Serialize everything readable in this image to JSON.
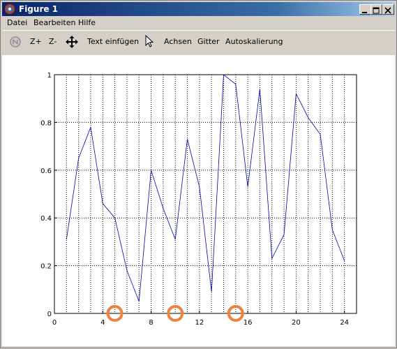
{
  "window": {
    "title": "Figure 1"
  },
  "menu": {
    "items": [
      "Datei",
      "Bearbeiten",
      "Hilfe"
    ]
  },
  "toolbar": {
    "zoom_in": "Z+",
    "zoom_out": "Z-",
    "insert_text": "Text einfügen",
    "axes": "Achsen",
    "grid": "Gitter",
    "autoscale": "Autoskalierung"
  },
  "chart_data": {
    "type": "line",
    "x": [
      1,
      2,
      3,
      4,
      5,
      6,
      7,
      8,
      9,
      10,
      11,
      12,
      13,
      14,
      15,
      16,
      17,
      18,
      19,
      20,
      21,
      22,
      23,
      24
    ],
    "series": [
      {
        "values": [
          0.31,
          0.65,
          0.78,
          0.46,
          0.4,
          0.18,
          0.05,
          0.6,
          0.44,
          0.31,
          0.73,
          0.53,
          0.09,
          1.0,
          0.96,
          0.53,
          0.94,
          0.23,
          0.33,
          0.92,
          0.82,
          0.75,
          0.35,
          0.22
        ],
        "color": "#0000aa"
      }
    ],
    "xlim": [
      0,
      25
    ],
    "ylim": [
      0,
      1
    ],
    "xticks": [
      0,
      4,
      8,
      12,
      16,
      20,
      24
    ],
    "yticks": [
      0,
      0.2,
      0.4,
      0.6,
      0.8,
      1
    ],
    "xtick_labels": [
      "0",
      "4",
      "8",
      "12",
      "16",
      "20",
      "24"
    ],
    "ytick_labels": [
      "0",
      "0.2",
      "0.4",
      "0.6",
      "0.8",
      "1"
    ],
    "grid": true,
    "grid_minor_x": [
      1,
      2,
      3,
      5,
      6,
      7,
      9,
      10,
      11,
      13,
      14,
      15,
      17,
      18,
      19,
      21,
      22,
      23
    ],
    "markers": {
      "x": [
        5,
        10,
        15
      ],
      "y": 0,
      "color": "#f08040"
    }
  }
}
